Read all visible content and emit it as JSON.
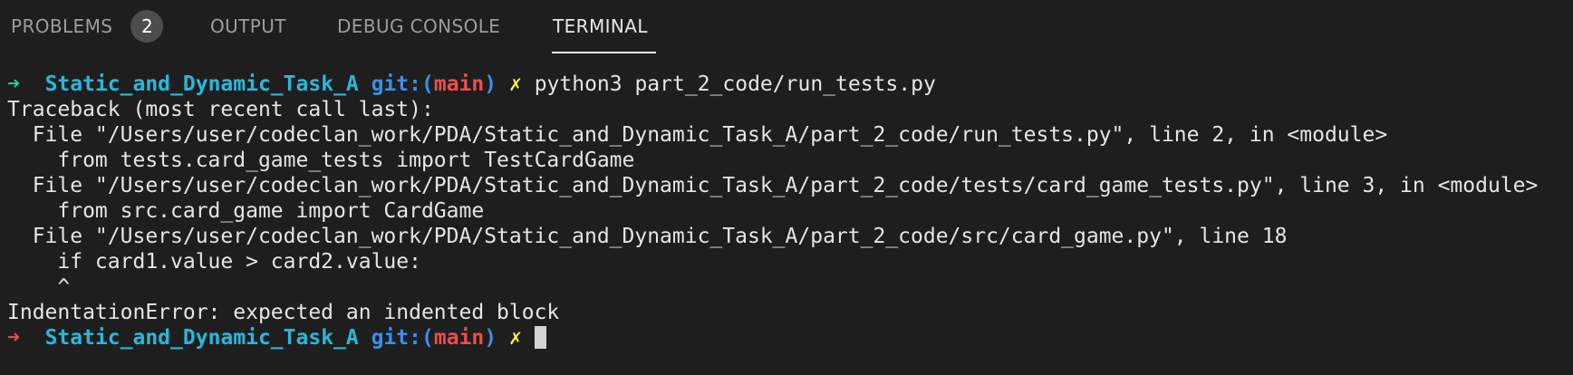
{
  "tabs": {
    "problems": {
      "label": "PROBLEMS",
      "badge": "2"
    },
    "output": {
      "label": "OUTPUT"
    },
    "debug": {
      "label": "DEBUG CONSOLE"
    },
    "terminal": {
      "label": "TERMINAL",
      "active": true
    }
  },
  "terminal": {
    "prompt1": {
      "arrow": "➜",
      "dir": "Static_and_Dynamic_Task_A",
      "git_label": "git:(",
      "branch": "main",
      "git_close": ")",
      "dirty": "✗",
      "command": "python3 part_2_code/run_tests.py"
    },
    "output_lines": [
      "Traceback (most recent call last):",
      "  File \"/Users/user/codeclan_work/PDA/Static_and_Dynamic_Task_A/part_2_code/run_tests.py\", line 2, in <module>",
      "    from tests.card_game_tests import TestCardGame",
      "  File \"/Users/user/codeclan_work/PDA/Static_and_Dynamic_Task_A/part_2_code/tests/card_game_tests.py\", line 3, in <module>",
      "    from src.card_game import CardGame",
      "  File \"/Users/user/codeclan_work/PDA/Static_and_Dynamic_Task_A/part_2_code/src/card_game.py\", line 18",
      "    if card1.value > card2.value:",
      "    ^",
      "IndentationError: expected an indented block"
    ],
    "prompt2": {
      "arrow": "➜",
      "dir": "Static_and_Dynamic_Task_A",
      "git_label": "git:(",
      "branch": "main",
      "git_close": ")",
      "dirty": "✗"
    }
  },
  "colors": {
    "background": "#1e1e1e",
    "arrow_success": "#23d18b",
    "arrow_error": "#f14c4c",
    "dir": "#29b8db",
    "git": "#3b8eea",
    "branch": "#f14c4c",
    "dirty": "#f5f543"
  }
}
